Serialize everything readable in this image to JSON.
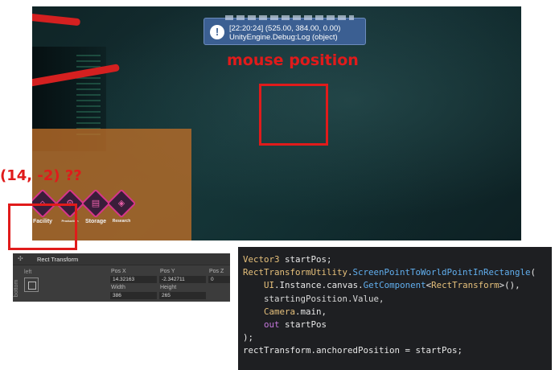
{
  "game_view": {
    "console": {
      "line1": "[22:20:24] (525.00, 384.00, 0.00)",
      "line2": "UnityEngine.Debug:Log (object)"
    },
    "hud": [
      {
        "label": "Facility",
        "icon": "factory-icon"
      },
      {
        "label": "Production",
        "icon": "production-icon"
      },
      {
        "label": "Storage",
        "icon": "storage-icon"
      },
      {
        "label": "Research",
        "icon": "research-icon"
      }
    ]
  },
  "annotations": {
    "mouse_label": "mouse position",
    "coord_label": "(14, -2) ??",
    "color": "#e01b1b"
  },
  "inspector": {
    "title": "Rect Transform",
    "anchor_left": "left",
    "anchor_bottom": "bottom",
    "pos_x_label": "Pos X",
    "pos_y_label": "Pos Y",
    "pos_z_label": "Pos Z",
    "pos_x": "14.32163",
    "pos_y": "-2.342711",
    "pos_z": "0",
    "width_label": "Width",
    "height_label": "Height",
    "width": "386",
    "height": "265"
  },
  "code": {
    "line1_type": "Vector3",
    "line1_rest": " startPos;",
    "line2_type": "RectTransformUtility",
    "line2_call": "ScreenPointToWorldPointInRectangle",
    "line3_a": "UI",
    "line3_b": "Instance",
    "line3_c": "canvas",
    "line3_call": "GetComponent",
    "line3_type": "RectTransform",
    "line4": "startingPosition.Value,",
    "line5_type": "Camera",
    "line5_rest": "main,",
    "line6_kw": "out",
    "line6_rest": " startPos",
    "line7": ");",
    "line8_a": "rectTransform",
    "line8_b": "anchoredPosition",
    "line8_c": " = startPos;"
  }
}
